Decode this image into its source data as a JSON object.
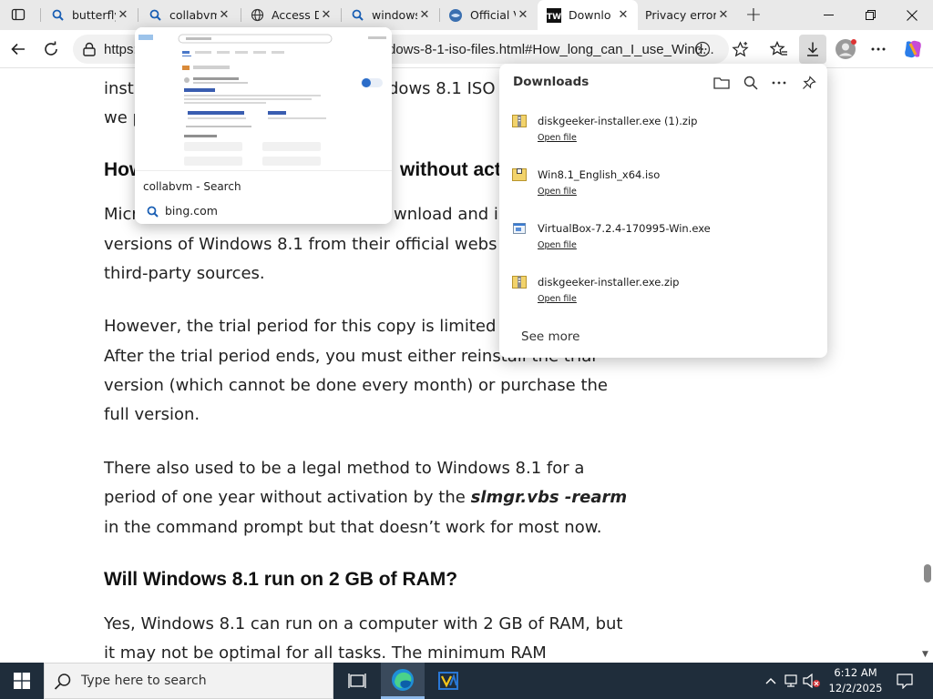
{
  "browser": {
    "tabs": [
      {
        "title": "butterfly",
        "icon": "search-icon"
      },
      {
        "title": "collabvm",
        "icon": "search-icon"
      },
      {
        "title": "Access D",
        "icon": "globe-icon"
      },
      {
        "title": "windows",
        "icon": "search-icon"
      },
      {
        "title": "Official V",
        "icon": "site-icon"
      },
      {
        "title": "Downlo",
        "icon": "tw-icon"
      },
      {
        "title": "Privacy error",
        "icon": ""
      }
    ],
    "address_prefix": "https:",
    "address_suffix": "dows-8-1-iso-files.html#How_long_can_I_use_Wind..."
  },
  "tab_preview": {
    "title": "collabvm - Search",
    "domain": "bing.com"
  },
  "article": {
    "line1": "insta",
    "line1_right": "dows 8.1 ISO",
    "line2": "we p",
    "heading1_left": "How",
    "heading1_right": "without act",
    "para1_line1_left": "Micr",
    "para1_line1_right": "wnload and in",
    "para1_line2": "versions of Windows 8.1 from their official webs",
    "para1_line3": "third-party sources.",
    "para2_line1": "However, the trial period for this copy is limited",
    "para2_line2": "After the trial period ends, you must either reinstall the trial",
    "para2_line3": "version (which cannot be done every month) or purchase the",
    "para2_line4": "full version.",
    "para3_line1": "There also used to be a legal method to Windows 8.1 for a",
    "para3_line2_a": "period of one year without activation by the ",
    "para3_line2_b": "slmgr.vbs -rearm",
    "para3_line3": "in the command prompt but that doesn’t work for most now.",
    "heading2": "Will Windows 8.1 run on 2 GB of RAM?",
    "para4_line1": "Yes, Windows 8.1 can run on a computer with 2 GB of RAM, but",
    "para4_line2": "it may not be optimal for all tasks. The minimum RAM"
  },
  "downloads": {
    "title": "Downloads",
    "items": [
      {
        "name": "diskgeeker-installer.exe (1).zip",
        "action": "Open file",
        "icon": "zip-file-icon"
      },
      {
        "name": "Win8.1_English_x64.iso",
        "action": "Open file",
        "icon": "iso-file-icon"
      },
      {
        "name": "VirtualBox-7.2.4-170995-Win.exe",
        "action": "Open file",
        "icon": "exe-file-icon"
      },
      {
        "name": "diskgeeker-installer.exe.zip",
        "action": "Open file",
        "icon": "zip-file-icon"
      }
    ],
    "see_more": "See more"
  },
  "taskbar": {
    "search_placeholder": "Type here to search",
    "time": "6:12 AM",
    "date": "12/2/2025"
  }
}
